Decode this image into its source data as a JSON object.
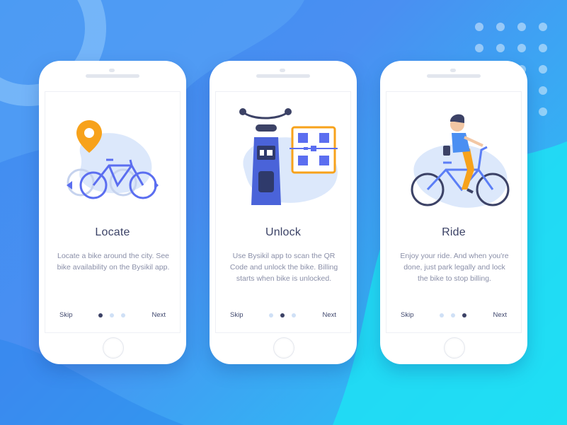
{
  "screens": [
    {
      "title": "Locate",
      "description": "Locate a bike around the city. See bike availability on the Bysikil app.",
      "skip_label": "Skip",
      "next_label": "Next",
      "active_dot": 1,
      "illustration": "map-pin-bike-icon"
    },
    {
      "title": "Unlock",
      "description": "Use Bysikil app to scan the QR Code and unlock the bike. Billing starts when bike is unlocked.",
      "skip_label": "Skip",
      "next_label": "Next",
      "active_dot": 2,
      "illustration": "qr-scan-bike-icon"
    },
    {
      "title": "Ride",
      "description": "Enjoy your ride. And when you're done, just park legally and lock the bike to stop billing.",
      "skip_label": "Skip",
      "next_label": "Next",
      "active_dot": 3,
      "illustration": "rider-on-bike-icon"
    }
  ],
  "colors": {
    "background_start": "#3d8ef0",
    "background_end": "#22d6f2",
    "title": "#3b4266",
    "body_text": "#8a8fa8",
    "accent_blue": "#5b7ef6",
    "accent_orange": "#f7a21b",
    "dot_active": "#3c4266",
    "dot_inactive": "#cfe0f6"
  }
}
